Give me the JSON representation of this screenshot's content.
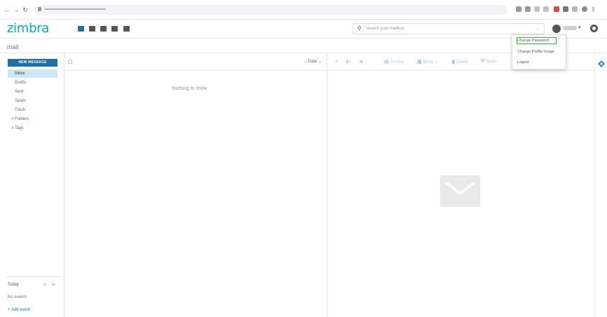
{
  "app": {
    "logo_text": "zimbra",
    "section_title": "mail"
  },
  "search": {
    "placeholder": "Search your mailbox"
  },
  "user_menu": {
    "items": [
      {
        "label": "Change Password",
        "highlighted": true
      },
      {
        "label": "Change Profile Image"
      },
      {
        "label": "Logout"
      }
    ]
  },
  "sidebar": {
    "new_message_label": "NEW MESSAGE",
    "folders": [
      {
        "label": "Inbox",
        "active": true
      },
      {
        "label": "Drafts"
      },
      {
        "label": "Sent"
      },
      {
        "label": "Spam"
      },
      {
        "label": "Trash"
      }
    ],
    "groups": [
      {
        "label": "> Folders"
      },
      {
        "label": "> Tags"
      }
    ],
    "calendar": {
      "today_label": "Today",
      "prev": "<",
      "next": ">",
      "no_events": "No events",
      "add_event": "+ Add event"
    }
  },
  "message_list": {
    "sort_label": "Date",
    "empty_text": "Nothing to show"
  },
  "reader_toolbar": {
    "archive": "Archive",
    "move": "Move",
    "delete": "Delete",
    "spam": "Spam"
  },
  "colors": {
    "brand": "#0aa2c7",
    "primary_button": "#1d6fa5",
    "active_folder": "#cfe6f3",
    "highlight_outline": "#29c229"
  }
}
